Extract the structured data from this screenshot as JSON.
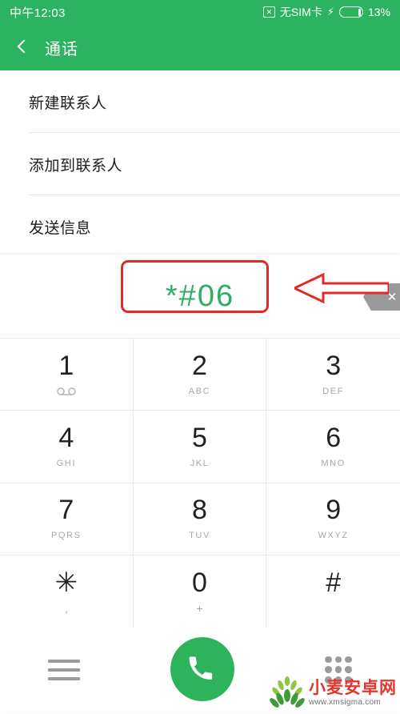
{
  "statusbar": {
    "clock": "中午12:03",
    "sim_icon": "sim-no-card-icon",
    "sim_text": "无SIM卡",
    "charging_icon": "lightning-bolt-icon",
    "battery_percent": "13%",
    "battery_level": 13
  },
  "appbar": {
    "back_icon": "chevron-left-icon",
    "title": "通话",
    "background_color": "#2CB35F"
  },
  "menu": {
    "items": [
      {
        "label": "新建联系人"
      },
      {
        "label": "添加到联系人"
      },
      {
        "label": "发送信息"
      }
    ]
  },
  "dialer": {
    "number": "*#06",
    "number_color": "#2EAE63",
    "backspace_icon": "backspace-delete-icon",
    "keys": [
      {
        "digit": "1",
        "sub": "",
        "icon": "voicemail-icon"
      },
      {
        "digit": "2",
        "sub": "ABC",
        "icon": ""
      },
      {
        "digit": "3",
        "sub": "DEF",
        "icon": ""
      },
      {
        "digit": "4",
        "sub": "GHI",
        "icon": ""
      },
      {
        "digit": "5",
        "sub": "JKL",
        "icon": ""
      },
      {
        "digit": "6",
        "sub": "MNO",
        "icon": ""
      },
      {
        "digit": "7",
        "sub": "PQRS",
        "icon": ""
      },
      {
        "digit": "8",
        "sub": "TUV",
        "icon": ""
      },
      {
        "digit": "9",
        "sub": "WXYZ",
        "icon": ""
      },
      {
        "digit": "✳",
        "sub": ",",
        "icon": ""
      },
      {
        "digit": "0",
        "sub": "+",
        "icon": ""
      },
      {
        "digit": "#",
        "sub": "",
        "icon": ""
      }
    ]
  },
  "bottombar": {
    "menu_icon": "hamburger-menu-icon",
    "call_icon": "phone-call-icon",
    "call_button_color": "#2EB35D",
    "keypad_icon": "dialpad-grid-icon"
  },
  "annotations": {
    "highlight_color": "#E02B26",
    "box_target": "*#06",
    "arrow_target": "backspace-delete-icon"
  },
  "watermark": {
    "site_name": "小麦安卓网",
    "url": "www.xmsigma.com",
    "logo_icon": "wheat-logo-icon"
  }
}
